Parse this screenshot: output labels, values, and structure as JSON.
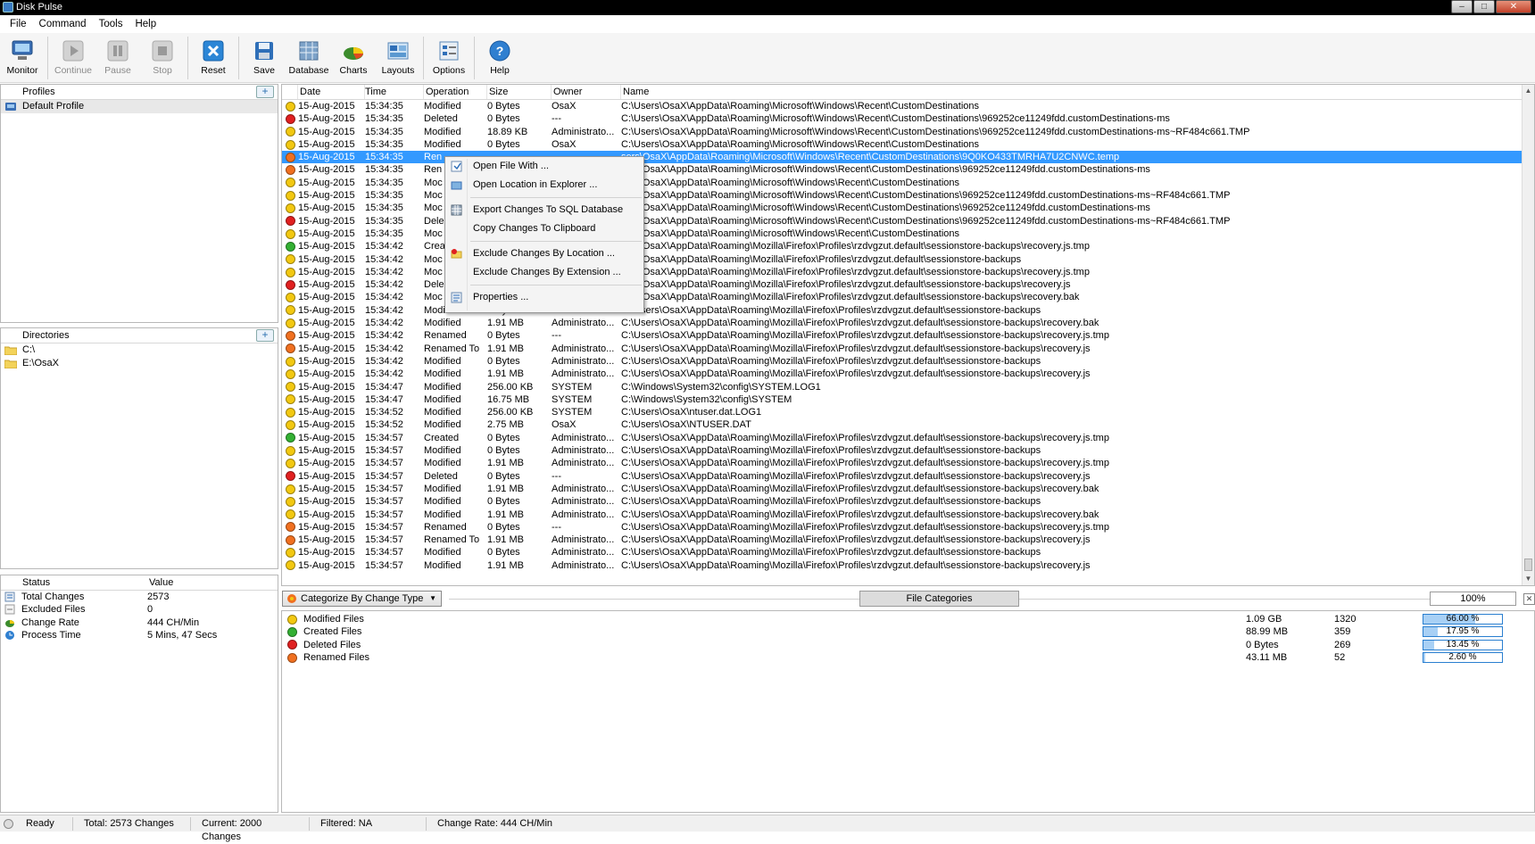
{
  "window": {
    "title": "Disk Pulse"
  },
  "menu": [
    "File",
    "Command",
    "Tools",
    "Help"
  ],
  "toolbar": [
    {
      "label": "Monitor",
      "icon": "monitor-icon",
      "enabled": true
    },
    {
      "label": "Continue",
      "icon": "play-icon",
      "enabled": false
    },
    {
      "label": "Pause",
      "icon": "pause-icon",
      "enabled": false
    },
    {
      "label": "Stop",
      "icon": "stop-icon",
      "enabled": false
    },
    {
      "label": "Reset",
      "icon": "reset-icon",
      "enabled": true
    },
    {
      "label": "Save",
      "icon": "save-icon",
      "enabled": true
    },
    {
      "label": "Database",
      "icon": "database-icon",
      "enabled": true
    },
    {
      "label": "Charts",
      "icon": "charts-icon",
      "enabled": true
    },
    {
      "label": "Layouts",
      "icon": "layouts-icon",
      "enabled": true
    },
    {
      "label": "Options",
      "icon": "options-icon",
      "enabled": true
    },
    {
      "label": "Help",
      "icon": "help-icon",
      "enabled": true
    }
  ],
  "profiles": {
    "header": "Profiles",
    "items": [
      "Default Profile"
    ]
  },
  "directories": {
    "header": "Directories",
    "items": [
      "C:\\",
      "E:\\OsaX"
    ]
  },
  "status": {
    "headers": [
      "Status",
      "Value"
    ],
    "rows": [
      {
        "key": "Total Changes",
        "value": "2573"
      },
      {
        "key": "Excluded Files",
        "value": "0"
      },
      {
        "key": "Change Rate",
        "value": "444 CH/Min"
      },
      {
        "key": "Process Time",
        "value": "5 Mins, 47 Secs"
      }
    ]
  },
  "colors": {
    "modified": "#f2c811",
    "deleted": "#e02020",
    "created": "#33b033",
    "renamed": "#f07020",
    "selection": "#3399ff"
  },
  "table": {
    "headers": [
      "Date",
      "Time",
      "Operation",
      "Size",
      "Owner",
      "Name"
    ],
    "selected_index": 4,
    "rows": [
      [
        "modified",
        "15-Aug-2015",
        "15:34:35",
        "Modified",
        "0 Bytes",
        "OsaX",
        "C:\\Users\\OsaX\\AppData\\Roaming\\Microsoft\\Windows\\Recent\\CustomDestinations"
      ],
      [
        "deleted",
        "15-Aug-2015",
        "15:34:35",
        "Deleted",
        "0 Bytes",
        "---",
        "C:\\Users\\OsaX\\AppData\\Roaming\\Microsoft\\Windows\\Recent\\CustomDestinations\\969252ce11249fdd.customDestinations-ms"
      ],
      [
        "modified",
        "15-Aug-2015",
        "15:34:35",
        "Modified",
        "18.89 KB",
        "Administrato...",
        "C:\\Users\\OsaX\\AppData\\Roaming\\Microsoft\\Windows\\Recent\\CustomDestinations\\969252ce11249fdd.customDestinations-ms~RF484c661.TMP"
      ],
      [
        "modified",
        "15-Aug-2015",
        "15:34:35",
        "Modified",
        "0 Bytes",
        "OsaX",
        "C:\\Users\\OsaX\\AppData\\Roaming\\Microsoft\\Windows\\Recent\\CustomDestinations"
      ],
      [
        "renamed",
        "15-Aug-2015",
        "15:34:35",
        "Ren",
        "",
        "",
        "sers\\OsaX\\AppData\\Roaming\\Microsoft\\Windows\\Recent\\CustomDestinations\\9Q0KO433TMRHA7U2CNWC.temp"
      ],
      [
        "renamed",
        "15-Aug-2015",
        "15:34:35",
        "Ren",
        "",
        "",
        "sers\\OsaX\\AppData\\Roaming\\Microsoft\\Windows\\Recent\\CustomDestinations\\969252ce11249fdd.customDestinations-ms"
      ],
      [
        "modified",
        "15-Aug-2015",
        "15:34:35",
        "Moc",
        "",
        "",
        "sers\\OsaX\\AppData\\Roaming\\Microsoft\\Windows\\Recent\\CustomDestinations"
      ],
      [
        "modified",
        "15-Aug-2015",
        "15:34:35",
        "Moc",
        "",
        "",
        "sers\\OsaX\\AppData\\Roaming\\Microsoft\\Windows\\Recent\\CustomDestinations\\969252ce11249fdd.customDestinations-ms~RF484c661.TMP"
      ],
      [
        "modified",
        "15-Aug-2015",
        "15:34:35",
        "Moc",
        "",
        "",
        "sers\\OsaX\\AppData\\Roaming\\Microsoft\\Windows\\Recent\\CustomDestinations\\969252ce11249fdd.customDestinations-ms"
      ],
      [
        "deleted",
        "15-Aug-2015",
        "15:34:35",
        "Dele",
        "",
        "",
        "sers\\OsaX\\AppData\\Roaming\\Microsoft\\Windows\\Recent\\CustomDestinations\\969252ce11249fdd.customDestinations-ms~RF484c661.TMP"
      ],
      [
        "modified",
        "15-Aug-2015",
        "15:34:35",
        "Moc",
        "",
        "",
        "sers\\OsaX\\AppData\\Roaming\\Microsoft\\Windows\\Recent\\CustomDestinations"
      ],
      [
        "created",
        "15-Aug-2015",
        "15:34:42",
        "Crea",
        "",
        "",
        "sers\\OsaX\\AppData\\Roaming\\Mozilla\\Firefox\\Profiles\\rzdvgzut.default\\sessionstore-backups\\recovery.js.tmp"
      ],
      [
        "modified",
        "15-Aug-2015",
        "15:34:42",
        "Moc",
        "",
        "",
        "sers\\OsaX\\AppData\\Roaming\\Mozilla\\Firefox\\Profiles\\rzdvgzut.default\\sessionstore-backups"
      ],
      [
        "modified",
        "15-Aug-2015",
        "15:34:42",
        "Moc",
        "",
        "",
        "sers\\OsaX\\AppData\\Roaming\\Mozilla\\Firefox\\Profiles\\rzdvgzut.default\\sessionstore-backups\\recovery.js.tmp"
      ],
      [
        "deleted",
        "15-Aug-2015",
        "15:34:42",
        "Dele",
        "",
        "",
        "sers\\OsaX\\AppData\\Roaming\\Mozilla\\Firefox\\Profiles\\rzdvgzut.default\\sessionstore-backups\\recovery.js"
      ],
      [
        "modified",
        "15-Aug-2015",
        "15:34:42",
        "Moc",
        "",
        "",
        "sers\\OsaX\\AppData\\Roaming\\Mozilla\\Firefox\\Profiles\\rzdvgzut.default\\sessionstore-backups\\recovery.bak"
      ],
      [
        "modified",
        "15-Aug-2015",
        "15:34:42",
        "Modified",
        "0 Bytes",
        "Administrato...",
        "C:\\Users\\OsaX\\AppData\\Roaming\\Mozilla\\Firefox\\Profiles\\rzdvgzut.default\\sessionstore-backups"
      ],
      [
        "modified",
        "15-Aug-2015",
        "15:34:42",
        "Modified",
        "1.91 MB",
        "Administrato...",
        "C:\\Users\\OsaX\\AppData\\Roaming\\Mozilla\\Firefox\\Profiles\\rzdvgzut.default\\sessionstore-backups\\recovery.bak"
      ],
      [
        "renamed",
        "15-Aug-2015",
        "15:34:42",
        "Renamed",
        "0 Bytes",
        "---",
        "C:\\Users\\OsaX\\AppData\\Roaming\\Mozilla\\Firefox\\Profiles\\rzdvgzut.default\\sessionstore-backups\\recovery.js.tmp"
      ],
      [
        "renamed",
        "15-Aug-2015",
        "15:34:42",
        "Renamed To",
        "1.91 MB",
        "Administrato...",
        "C:\\Users\\OsaX\\AppData\\Roaming\\Mozilla\\Firefox\\Profiles\\rzdvgzut.default\\sessionstore-backups\\recovery.js"
      ],
      [
        "modified",
        "15-Aug-2015",
        "15:34:42",
        "Modified",
        "0 Bytes",
        "Administrato...",
        "C:\\Users\\OsaX\\AppData\\Roaming\\Mozilla\\Firefox\\Profiles\\rzdvgzut.default\\sessionstore-backups"
      ],
      [
        "modified",
        "15-Aug-2015",
        "15:34:42",
        "Modified",
        "1.91 MB",
        "Administrato...",
        "C:\\Users\\OsaX\\AppData\\Roaming\\Mozilla\\Firefox\\Profiles\\rzdvgzut.default\\sessionstore-backups\\recovery.js"
      ],
      [
        "modified",
        "15-Aug-2015",
        "15:34:47",
        "Modified",
        "256.00 KB",
        "SYSTEM",
        "C:\\Windows\\System32\\config\\SYSTEM.LOG1"
      ],
      [
        "modified",
        "15-Aug-2015",
        "15:34:47",
        "Modified",
        "16.75 MB",
        "SYSTEM",
        "C:\\Windows\\System32\\config\\SYSTEM"
      ],
      [
        "modified",
        "15-Aug-2015",
        "15:34:52",
        "Modified",
        "256.00 KB",
        "SYSTEM",
        "C:\\Users\\OsaX\\ntuser.dat.LOG1"
      ],
      [
        "modified",
        "15-Aug-2015",
        "15:34:52",
        "Modified",
        "2.75 MB",
        "OsaX",
        "C:\\Users\\OsaX\\NTUSER.DAT"
      ],
      [
        "created",
        "15-Aug-2015",
        "15:34:57",
        "Created",
        "0 Bytes",
        "Administrato...",
        "C:\\Users\\OsaX\\AppData\\Roaming\\Mozilla\\Firefox\\Profiles\\rzdvgzut.default\\sessionstore-backups\\recovery.js.tmp"
      ],
      [
        "modified",
        "15-Aug-2015",
        "15:34:57",
        "Modified",
        "0 Bytes",
        "Administrato...",
        "C:\\Users\\OsaX\\AppData\\Roaming\\Mozilla\\Firefox\\Profiles\\rzdvgzut.default\\sessionstore-backups"
      ],
      [
        "modified",
        "15-Aug-2015",
        "15:34:57",
        "Modified",
        "1.91 MB",
        "Administrato...",
        "C:\\Users\\OsaX\\AppData\\Roaming\\Mozilla\\Firefox\\Profiles\\rzdvgzut.default\\sessionstore-backups\\recovery.js.tmp"
      ],
      [
        "deleted",
        "15-Aug-2015",
        "15:34:57",
        "Deleted",
        "0 Bytes",
        "---",
        "C:\\Users\\OsaX\\AppData\\Roaming\\Mozilla\\Firefox\\Profiles\\rzdvgzut.default\\sessionstore-backups\\recovery.js"
      ],
      [
        "modified",
        "15-Aug-2015",
        "15:34:57",
        "Modified",
        "1.91 MB",
        "Administrato...",
        "C:\\Users\\OsaX\\AppData\\Roaming\\Mozilla\\Firefox\\Profiles\\rzdvgzut.default\\sessionstore-backups\\recovery.bak"
      ],
      [
        "modified",
        "15-Aug-2015",
        "15:34:57",
        "Modified",
        "0 Bytes",
        "Administrato...",
        "C:\\Users\\OsaX\\AppData\\Roaming\\Mozilla\\Firefox\\Profiles\\rzdvgzut.default\\sessionstore-backups"
      ],
      [
        "modified",
        "15-Aug-2015",
        "15:34:57",
        "Modified",
        "1.91 MB",
        "Administrato...",
        "C:\\Users\\OsaX\\AppData\\Roaming\\Mozilla\\Firefox\\Profiles\\rzdvgzut.default\\sessionstore-backups\\recovery.bak"
      ],
      [
        "renamed",
        "15-Aug-2015",
        "15:34:57",
        "Renamed",
        "0 Bytes",
        "---",
        "C:\\Users\\OsaX\\AppData\\Roaming\\Mozilla\\Firefox\\Profiles\\rzdvgzut.default\\sessionstore-backups\\recovery.js.tmp"
      ],
      [
        "renamed",
        "15-Aug-2015",
        "15:34:57",
        "Renamed To",
        "1.91 MB",
        "Administrato...",
        "C:\\Users\\OsaX\\AppData\\Roaming\\Mozilla\\Firefox\\Profiles\\rzdvgzut.default\\sessionstore-backups\\recovery.js"
      ],
      [
        "modified",
        "15-Aug-2015",
        "15:34:57",
        "Modified",
        "0 Bytes",
        "Administrato...",
        "C:\\Users\\OsaX\\AppData\\Roaming\\Mozilla\\Firefox\\Profiles\\rzdvgzut.default\\sessionstore-backups"
      ],
      [
        "modified",
        "15-Aug-2015",
        "15:34:57",
        "Modified",
        "1.91 MB",
        "Administrato...",
        "C:\\Users\\OsaX\\AppData\\Roaming\\Mozilla\\Firefox\\Profiles\\rzdvgzut.default\\sessionstore-backups\\recovery.js"
      ]
    ]
  },
  "context_menu": {
    "groups": [
      [
        {
          "label": "Open File With ...",
          "icon": "open-with-icon"
        },
        {
          "label": "Open Location in Explorer ...",
          "icon": "folder-icon"
        }
      ],
      [
        {
          "label": "Export Changes To SQL Database",
          "icon": "database-icon"
        },
        {
          "label": "Copy Changes To Clipboard",
          "icon": ""
        }
      ],
      [
        {
          "label": "Exclude Changes By Location ...",
          "icon": "exclude-folder-icon"
        },
        {
          "label": "Exclude Changes By Extension ...",
          "icon": ""
        }
      ],
      [
        {
          "label": "Properties ...",
          "icon": "properties-icon"
        }
      ]
    ]
  },
  "category_bar": {
    "selected": "Categorize By Change Type",
    "button": "File Categories",
    "zoom": "100%"
  },
  "categories": [
    {
      "type": "modified",
      "name": "Modified Files",
      "size": "1.09 GB",
      "count": "1320",
      "percent": 66.0,
      "label": "66.00 %"
    },
    {
      "type": "created",
      "name": "Created Files",
      "size": "88.99 MB",
      "count": "359",
      "percent": 17.95,
      "label": "17.95 %"
    },
    {
      "type": "deleted",
      "name": "Deleted Files",
      "size": "0 Bytes",
      "count": "269",
      "percent": 13.45,
      "label": "13.45 %"
    },
    {
      "type": "renamed",
      "name": "Renamed Files",
      "size": "43.11 MB",
      "count": "52",
      "percent": 2.6,
      "label": "2.60 %"
    }
  ],
  "statusbar": {
    "ready": "Ready",
    "total": "Total: 2573 Changes",
    "current": "Current: 2000 Changes",
    "filtered": "Filtered: NA",
    "rate": "Change Rate: 444 CH/Min"
  }
}
